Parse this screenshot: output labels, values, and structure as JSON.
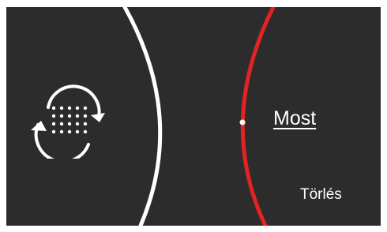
{
  "colors": {
    "background": "#2c2c2c",
    "left_arc": "#ffffff",
    "right_arc": "#e32222",
    "text": "#ffffff"
  },
  "icons": {
    "cycle": "refresh-dots-icon"
  },
  "actions": {
    "now_label": "Most",
    "clear_label": "Törlés"
  }
}
